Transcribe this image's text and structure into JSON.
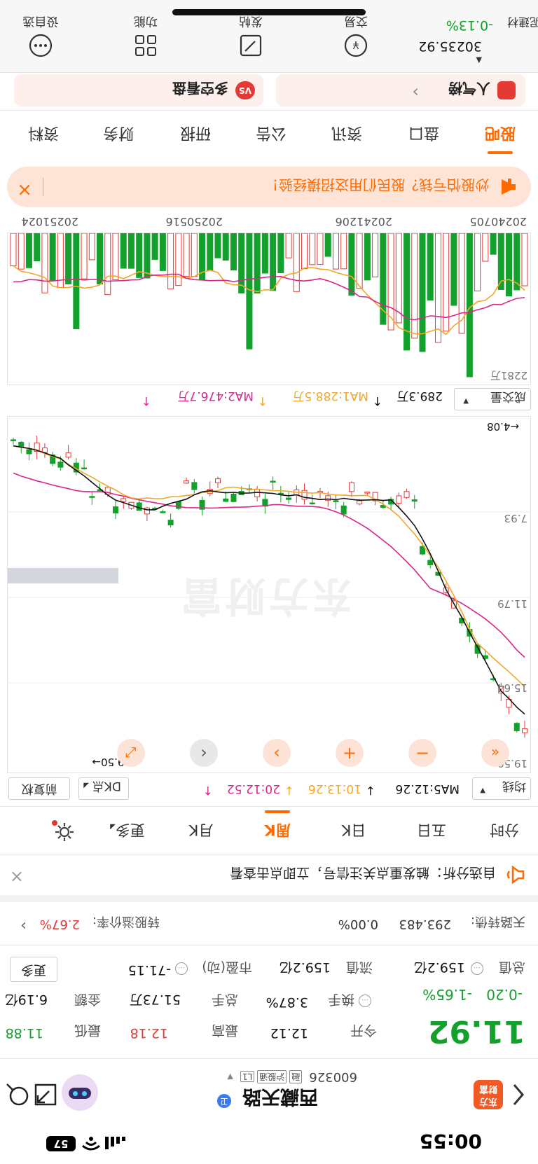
{
  "status_bar": {
    "time": "00:55",
    "battery": "57"
  },
  "header": {
    "name": "西藏天路",
    "code": "600326",
    "tags": [
      "融",
      "沪股通",
      "L1"
    ]
  },
  "quote": {
    "price": "11.92",
    "change": "-0.20",
    "change_pct": "-1.65%",
    "open_label": "今开",
    "open": "12.12",
    "high_label": "最高",
    "high": "12.18",
    "low_label": "最低",
    "low": "11.88",
    "turnover_label": "换手",
    "turnover": "3.87%",
    "volume_label": "总手",
    "volume": "51.73万",
    "amount_label": "金额",
    "amount": "6.19亿",
    "mktcap_label": "总值",
    "mktcap": "159.2亿",
    "float_label": "流值",
    "float_cap": "159.2亿",
    "pe_label": "市盈(动)",
    "pe": "-71.15",
    "more": "更多"
  },
  "bond": {
    "name": "天路转债:",
    "price": "293.483",
    "pct": "0.00%",
    "premium_label": "转股溢价率:",
    "premium": "2.67%"
  },
  "notice": "自选分析：触发重点关注信号，立即点击查看",
  "period_tabs": [
    "分时",
    "五日",
    "日K",
    "周K",
    "月K",
    "更多"
  ],
  "active_period": "周K",
  "kline": {
    "indicator": "均线",
    "ma5": "MA5:12.26",
    "ma10": "10:13.26",
    "ma20": "20:12.52",
    "dk": "DK点",
    "fq": "前复权",
    "y_labels": [
      "19.50",
      "15.64",
      "11.79",
      "7.93"
    ],
    "max_label": "19.50",
    "min_label": "4.08",
    "watermark": "东方财富"
  },
  "volume": {
    "title": "成交量",
    "current": "289.3万",
    "ma1": "MA1:288.5万",
    "ma2": "MA2:476.7万",
    "max_label": "2281万",
    "dates": [
      "20240705",
      "20241206",
      "20250516",
      "20251024"
    ]
  },
  "ad_banner": "炒股怕亏钱？股民们用这招摸经验！",
  "info_tabs": [
    "股吧",
    "盘口",
    "资讯",
    "公告",
    "研报",
    "财务",
    "资料"
  ],
  "active_info_tab": "股吧",
  "cards": {
    "left": "人气榜",
    "right": "多空看盘"
  },
  "bottom_bar": {
    "index_name": "水泥建材",
    "index_value": "30235.92",
    "index_pct": "-0.13%",
    "items": [
      "交易",
      "发帖",
      "功能",
      "设自选"
    ]
  },
  "colors": {
    "up": "#e43a35",
    "down": "#14a02c",
    "accent": "#ff6a00",
    "ma5": "#111111",
    "ma10": "#f2a72a",
    "ma20": "#d8278c"
  }
}
